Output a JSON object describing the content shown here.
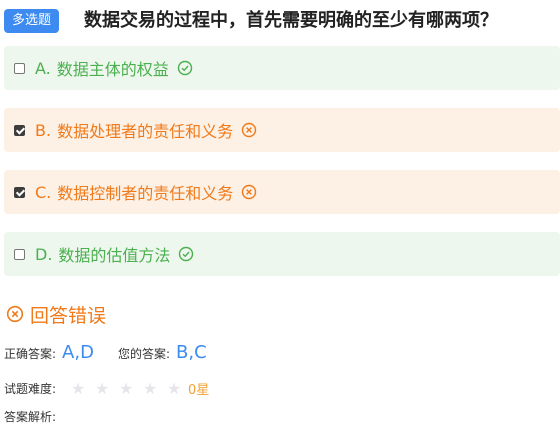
{
  "question": {
    "type_badge": "多选题",
    "title": "数据交易的过程中，首先需要明确的至少有哪两项？"
  },
  "options": [
    {
      "letter": "A.",
      "text": "数据主体的权益",
      "checked": false,
      "status": "correct"
    },
    {
      "letter": "B.",
      "text": "数据处理者的责任和义务",
      "checked": true,
      "status": "wrong"
    },
    {
      "letter": "C.",
      "text": "数据控制者的责任和义务",
      "checked": true,
      "status": "wrong"
    },
    {
      "letter": "D.",
      "text": "数据的估值方法",
      "checked": false,
      "status": "correct"
    }
  ],
  "result": {
    "text": "回答错误"
  },
  "answers": {
    "correct_label": "正确答案:",
    "correct_value": "A,D",
    "yours_label": "您的答案:",
    "yours_value": "B,C"
  },
  "difficulty": {
    "label": "试题难度:",
    "rating": 0,
    "max": 5,
    "text": "0星"
  },
  "analysis": {
    "label": "答案解析:"
  },
  "colors": {
    "accent": "#3d8bf0",
    "correct": "#4caf50",
    "wrong": "#f07a1a",
    "correct_bg": "#edf7ed",
    "wrong_bg": "#fdf0e4"
  }
}
